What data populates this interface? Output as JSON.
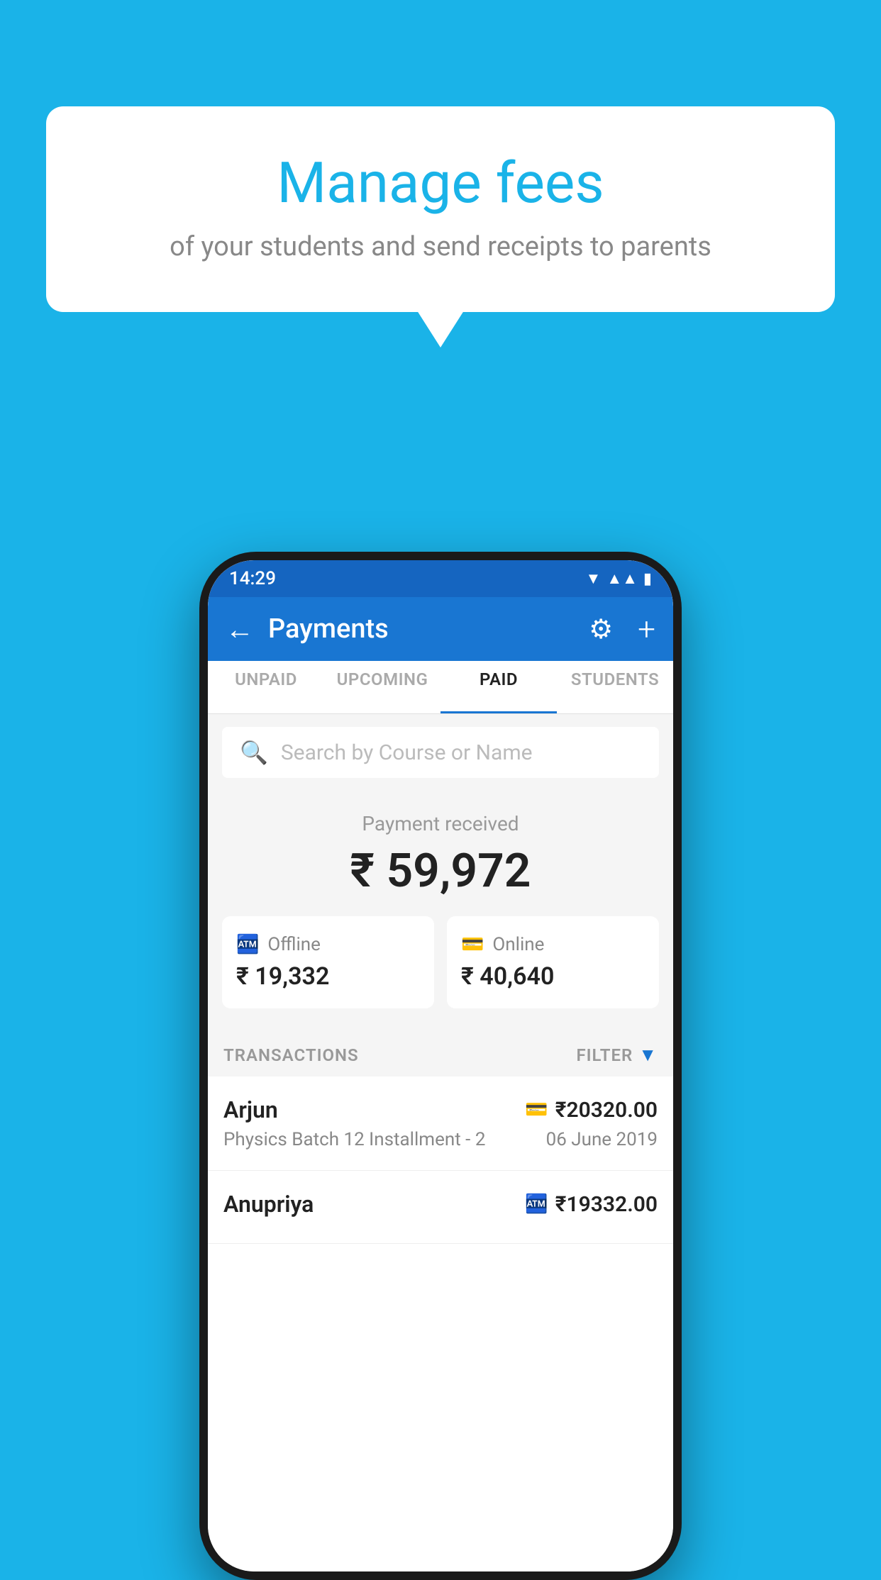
{
  "background_color": "#1ab3e8",
  "speech_bubble": {
    "title": "Manage fees",
    "subtitle": "of your students and send receipts to parents"
  },
  "phone": {
    "status_bar": {
      "time": "14:29",
      "icons": [
        "wifi",
        "signal",
        "battery"
      ]
    },
    "header": {
      "title": "Payments",
      "back_label": "←",
      "gear_label": "⚙",
      "plus_label": "+"
    },
    "tabs": [
      {
        "label": "UNPAID",
        "active": false
      },
      {
        "label": "UPCOMING",
        "active": false
      },
      {
        "label": "PAID",
        "active": true
      },
      {
        "label": "STUDENTS",
        "active": false
      }
    ],
    "search": {
      "placeholder": "Search by Course or Name"
    },
    "payment_summary": {
      "label": "Payment received",
      "total": "₹ 59,972",
      "offline": {
        "type": "Offline",
        "amount": "₹ 19,332"
      },
      "online": {
        "type": "Online",
        "amount": "₹ 40,640"
      }
    },
    "transactions": {
      "header_label": "TRANSACTIONS",
      "filter_label": "FILTER",
      "rows": [
        {
          "name": "Arjun",
          "amount": "₹20320.00",
          "course": "Physics Batch 12 Installment - 2",
          "date": "06 June 2019",
          "mode": "card"
        },
        {
          "name": "Anupriya",
          "amount": "₹19332.00",
          "course": "",
          "date": "",
          "mode": "cash"
        }
      ]
    }
  }
}
